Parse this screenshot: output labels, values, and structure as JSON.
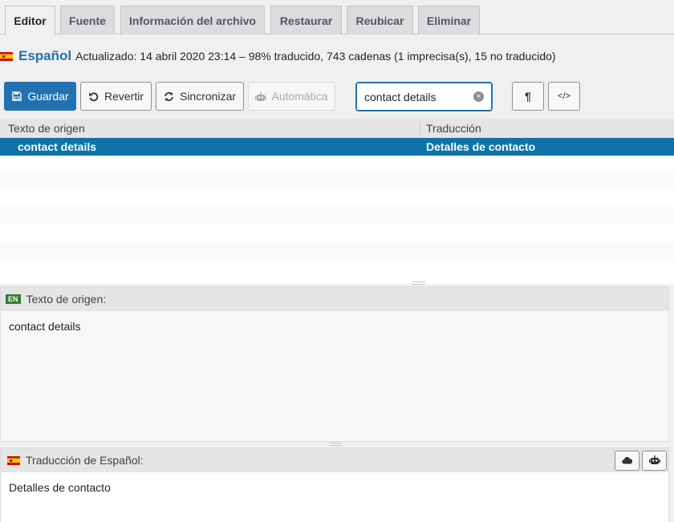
{
  "tabs": [
    {
      "label": "Editor",
      "active": true
    },
    {
      "label": "Fuente"
    },
    {
      "label": "Información del archivo"
    },
    {
      "label": "Restaurar"
    },
    {
      "label": "Reubicar"
    },
    {
      "label": "Eliminar"
    }
  ],
  "status": {
    "language": "Español",
    "meta": "Actualizado: 14 abril 2020 23:14 – 98% traducido, 743 cadenas (1 imprecisa(s), 15 no traducido)"
  },
  "toolbar": {
    "save_label": "Guardar",
    "revert_label": "Revertir",
    "sync_label": "Sincronizar",
    "auto_label": "Automática",
    "search_value": "contact details",
    "pilcrow_icon": "¶",
    "code_icon": "</>"
  },
  "grid": {
    "columns": [
      "Texto de origen",
      "Traducción"
    ],
    "rows": [
      {
        "source": "contact details",
        "translation": "Detalles de contacto",
        "selected": true
      }
    ]
  },
  "source_pane": {
    "badge": "EN",
    "title": "Texto de origen:",
    "text": "contact details"
  },
  "translation_pane": {
    "title": "Traducción de Español:",
    "text": "Detalles de contacto"
  },
  "colors": {
    "accent": "#2271b1",
    "selected_row": "#0f73a8"
  }
}
